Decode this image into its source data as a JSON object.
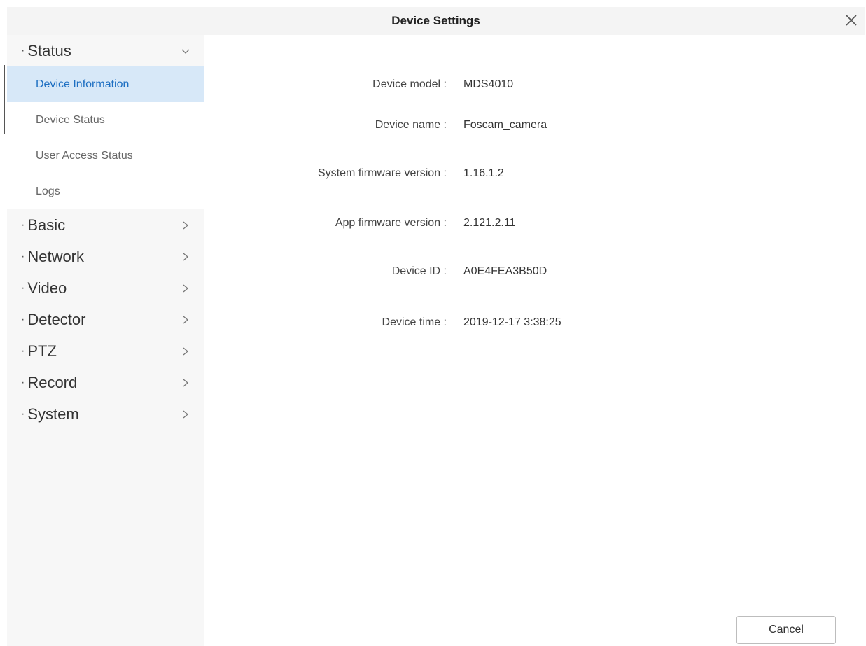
{
  "window": {
    "title": "Device Settings"
  },
  "sidebar": {
    "groups": [
      {
        "label": "Status",
        "expanded": true,
        "items": [
          "Device Information",
          "Device Status",
          "User Access Status",
          "Logs"
        ],
        "active_item": "Device Information"
      },
      {
        "label": "Basic",
        "expanded": false
      },
      {
        "label": "Network",
        "expanded": false
      },
      {
        "label": "Video",
        "expanded": false
      },
      {
        "label": "Detector",
        "expanded": false
      },
      {
        "label": "PTZ",
        "expanded": false
      },
      {
        "label": "Record",
        "expanded": false
      },
      {
        "label": "System",
        "expanded": false
      }
    ],
    "bullet": "·"
  },
  "info": {
    "device_model": {
      "label": "Device model :",
      "value": "MDS4010"
    },
    "device_name": {
      "label": "Device name :",
      "value": "Foscam_camera"
    },
    "system_firmware": {
      "label": "System firmware version :",
      "value": "1.16.1.2"
    },
    "app_firmware": {
      "label": "App firmware version :",
      "value": "2.121.2.11"
    },
    "device_id": {
      "label": "Device ID :",
      "value": "A0E4FEA3B50D"
    },
    "device_time": {
      "label": "Device time :",
      "value": "2019-12-17 3:38:25"
    }
  },
  "footer": {
    "cancel_label": "Cancel"
  },
  "colors": {
    "active_bg": "#d7e8f8",
    "active_text": "#1e6fc2",
    "sidebar_bg": "#f7f7f7"
  },
  "icons": {
    "close": "close-icon",
    "expanded": "chevron-down-icon",
    "collapsed": "chevron-right-icon"
  }
}
